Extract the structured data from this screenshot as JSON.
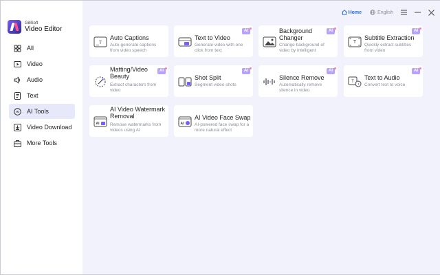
{
  "app": {
    "brand_small": "GiliSoft",
    "brand_name": "Video Editor"
  },
  "topbar": {
    "home_label": "Home",
    "language_label": "English"
  },
  "sidebar": {
    "items": [
      {
        "label": "All",
        "icon": "grid-icon"
      },
      {
        "label": "Video",
        "icon": "play-icon"
      },
      {
        "label": "Audio",
        "icon": "speaker-icon"
      },
      {
        "label": "Text",
        "icon": "text-doc-icon"
      },
      {
        "label": "AI Tools",
        "icon": "ai-icon",
        "active": true
      },
      {
        "label": "Video Download",
        "icon": "download-icon"
      },
      {
        "label": "More Tools",
        "icon": "tools-icon"
      }
    ]
  },
  "tools": [
    {
      "title": "Auto Captions",
      "desc": "Auto-generate captions from video speech",
      "ai": false
    },
    {
      "title": "Text to Video",
      "desc": "Generate video with one click from text",
      "ai": true
    },
    {
      "title": "Background Changer",
      "desc": "Change background of video by intelligent",
      "ai": true
    },
    {
      "title": "Subtitle Extraction",
      "desc": "Quickly extract subtitles from video",
      "ai": true
    },
    {
      "title": "Matting/Video Beauty",
      "desc": "Extract characters from video",
      "ai": true
    },
    {
      "title": "Shot Split",
      "desc": "Segment video shots",
      "ai": true
    },
    {
      "title": "Silence Remove",
      "desc": "Automatically remove silence in video",
      "ai": true
    },
    {
      "title": "Text to Audio",
      "desc": "Convert text to voice",
      "ai": true
    },
    {
      "title": "AI Video Watermark Removal",
      "desc": "Remove watermarks from videos using AI",
      "ai": false
    },
    {
      "title": "AI Video Face Swap",
      "desc": "AI-powered face swap for a more natural effect",
      "ai": false
    }
  ],
  "badge_label": "AI",
  "colors": {
    "accent": "#2b6fd6",
    "active_nav_bg": "#e7e9fb",
    "main_bg": "#f1f2fb",
    "ai_badge": "#b7a4f8"
  }
}
